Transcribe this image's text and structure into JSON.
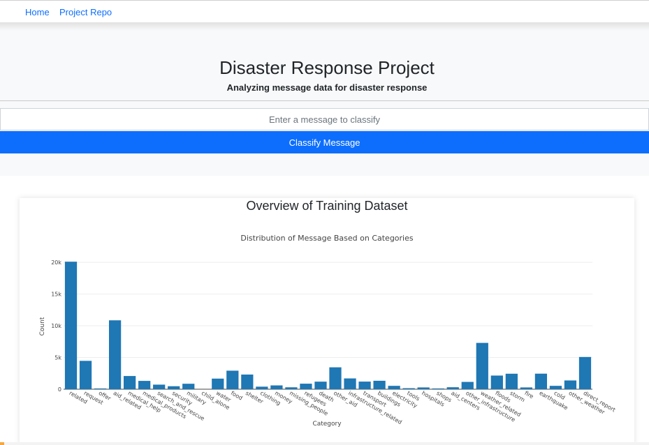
{
  "nav": {
    "home": "Home",
    "repo": "Project Repo"
  },
  "hero": {
    "title": "Disaster Response Project",
    "subtitle": "Analyzing message data for disaster response",
    "input_placeholder": "Enter a message to classify",
    "button_label": "Classify Message"
  },
  "section": {
    "title": "Overview of Training Dataset"
  },
  "colors": {
    "bar": "#1f77b4",
    "primary": "#0d6efd"
  },
  "chart_data": {
    "type": "bar",
    "title": "Distribution of Message Based on Categories",
    "xlabel": "Category",
    "ylabel": "Count",
    "ylim": [
      0,
      21000
    ],
    "yticks": [
      0,
      5000,
      10000,
      15000,
      20000
    ],
    "yticklabels": [
      "0",
      "5k",
      "10k",
      "15k",
      "20k"
    ],
    "grid": true,
    "categories": [
      "related",
      "request",
      "offer",
      "aid_related",
      "medical_help",
      "medical_products",
      "search_and_rescue",
      "security",
      "military",
      "child_alone",
      "water",
      "food",
      "shelter",
      "clothing",
      "money",
      "missing_people",
      "refugees",
      "death",
      "other_aid",
      "infrastructure_related",
      "transport",
      "buildings",
      "electricity",
      "tools",
      "hospitals",
      "shops",
      "aid_centers",
      "other_infrastructure",
      "weather_related",
      "floods",
      "storm",
      "fire",
      "earthquake",
      "cold",
      "other_weather",
      "direct_report"
    ],
    "values": [
      20100,
      4470,
      120,
      10860,
      2080,
      1310,
      720,
      470,
      860,
      0,
      1670,
      2920,
      2310,
      400,
      600,
      300,
      870,
      1190,
      3450,
      1700,
      1200,
      1330,
      530,
      160,
      280,
      120,
      310,
      1150,
      7300,
      2150,
      2440,
      280,
      2450,
      530,
      1380,
      5080
    ]
  }
}
